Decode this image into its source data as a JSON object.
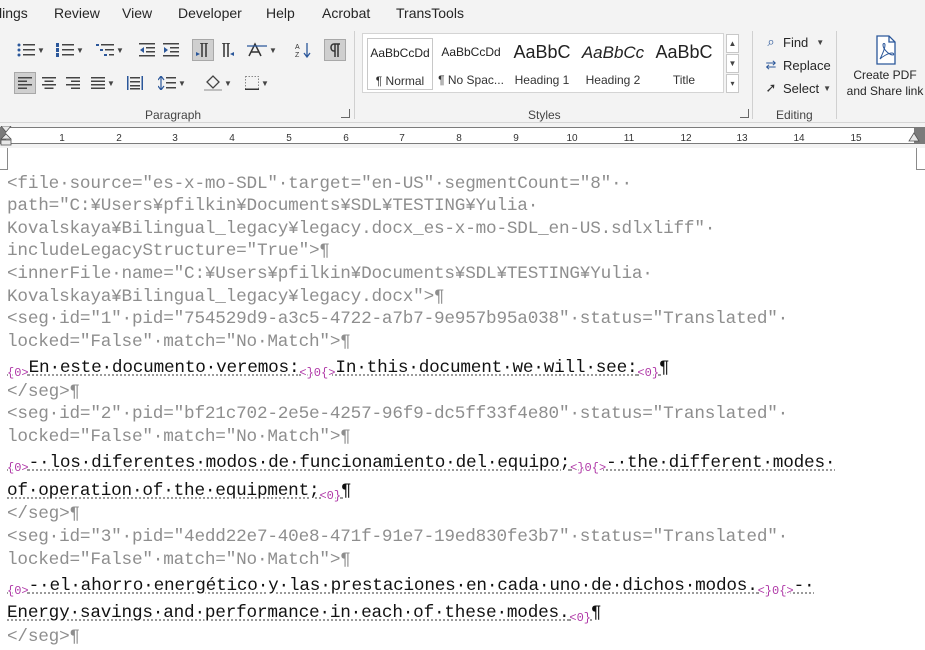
{
  "menu": {
    "tabs": [
      "lings",
      "Review",
      "View",
      "Developer",
      "Help",
      "Acrobat",
      "TransTools"
    ]
  },
  "ribbon": {
    "groups": {
      "paragraph": "Paragraph",
      "styles": "Styles",
      "editing": "Editing"
    },
    "styles": [
      {
        "preview": "AaBbCcDd",
        "name": "¶ Normal"
      },
      {
        "preview": "AaBbCcDd",
        "name": "¶ No Spac..."
      },
      {
        "preview": "AaBbC",
        "name": "Heading 1"
      },
      {
        "preview": "AaBbCc",
        "name": "Heading 2"
      },
      {
        "preview": "AaBbC",
        "name": "Title"
      }
    ],
    "editing": {
      "find": "Find",
      "replace": "Replace",
      "select": "Select"
    },
    "create_pdf": {
      "line1": "Create PDF",
      "line2": "and Share link"
    }
  },
  "ruler": {
    "numbers": [
      "1",
      "2",
      "3",
      "4",
      "5",
      "6",
      "7",
      "8",
      "9",
      "10",
      "11",
      "12",
      "13",
      "14",
      "15"
    ]
  },
  "document": {
    "lines": [
      "<file·source=\"es-x-mo-SDL\"·target=\"en-US\"·segmentCount=\"8\"··",
      "path=\"C:¥Users¥pfilkin¥Documents¥SDL¥TESTING¥Yulia·",
      "Kovalskaya¥Bilingual_legacy¥legacy.docx_es-x-mo-SDL_en-US.sdlxliff\"·",
      "includeLegacyStructure=\"True\">¶",
      "<innerFile·name=\"C:¥Users¥pfilkin¥Documents¥SDL¥TESTING¥Yulia·",
      "Kovalskaya¥Bilingual_legacy¥legacy.docx\">¶",
      "<seg·id=\"1\"·pid=\"754529d9-a3c5-4722-a7b7-9e957b95a038\"·status=\"Translated\"·",
      "locked=\"False\"·match=\"No·Match\">¶",
      "</seg>¶",
      "<seg·id=\"2\"·pid=\"bf21c702-2e5e-4257-96f9-dc5ff33f4e80\"·status=\"Translated\"·",
      "locked=\"False\"·match=\"No·Match\">¶",
      "</seg>¶",
      "<seg·id=\"3\"·pid=\"4edd22e7-40e8-471f-91e7-19ed830fe3b7\"·status=\"Translated\"·",
      "locked=\"False\"·match=\"No·Match\">¶",
      "</seg>¶"
    ],
    "tags": {
      "open": "{0>",
      "mid": "<}0{>",
      "close": "<0}"
    },
    "segments": [
      {
        "source": "En·este·documento·veremos:",
        "target": "In·this·document·we·will·see:",
        "end": "¶"
      },
      {
        "source": "-·los·diferentes·modos·de·funcionamiento·del·equipo;",
        "target": "-·the·different·modes·",
        "target_cont": "of·operation·of·the·equipment;",
        "end": "¶"
      },
      {
        "source": "-·el·ahorro·energético·y·las·prestaciones·en·cada·uno·de·dichos·modos.",
        "target": "-·",
        "target_cont": "Energy·savings·and·performance·in·each·of·these·modes.",
        "end": "¶"
      }
    ]
  }
}
